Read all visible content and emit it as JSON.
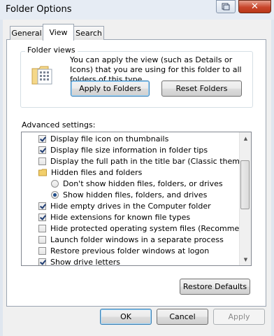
{
  "window": {
    "title": "Folder Options"
  },
  "tabs": [
    {
      "label": "General"
    },
    {
      "label": "View"
    },
    {
      "label": "Search"
    }
  ],
  "folder_views": {
    "legend": "Folder views",
    "description": "You can apply the view (such as Details or Icons) that you are using for this folder to all folders of this type.",
    "apply_button": "Apply to Folders",
    "reset_button": "Reset Folders"
  },
  "advanced": {
    "label": "Advanced settings:",
    "items": [
      {
        "type": "checkbox",
        "checked": true,
        "label": "Display file icon on thumbnails"
      },
      {
        "type": "checkbox",
        "checked": true,
        "label": "Display file size information in folder tips"
      },
      {
        "type": "checkbox",
        "checked": false,
        "label": "Display the full path in the title bar (Classic theme only)"
      },
      {
        "type": "folder",
        "label": "Hidden files and folders"
      },
      {
        "type": "radio",
        "checked": false,
        "label": "Don't show hidden files, folders, or drives"
      },
      {
        "type": "radio",
        "checked": true,
        "label": "Show hidden files, folders, and drives"
      },
      {
        "type": "checkbox",
        "checked": true,
        "label": "Hide empty drives in the Computer folder"
      },
      {
        "type": "checkbox",
        "checked": true,
        "label": "Hide extensions for known file types"
      },
      {
        "type": "checkbox",
        "checked": false,
        "label": "Hide protected operating system files (Recommended)"
      },
      {
        "type": "checkbox",
        "checked": false,
        "label": "Launch folder windows in a separate process"
      },
      {
        "type": "checkbox",
        "checked": false,
        "label": "Restore previous folder windows at logon"
      },
      {
        "type": "checkbox",
        "checked": true,
        "label": "Show drive letters"
      }
    ],
    "restore_defaults": "Restore Defaults"
  },
  "footer": {
    "ok": "OK",
    "cancel": "Cancel",
    "apply": "Apply"
  },
  "colors": {
    "close_button": "#c8462c",
    "selected_tab": "#ffffff",
    "panel_border": "#9ba5b2"
  }
}
